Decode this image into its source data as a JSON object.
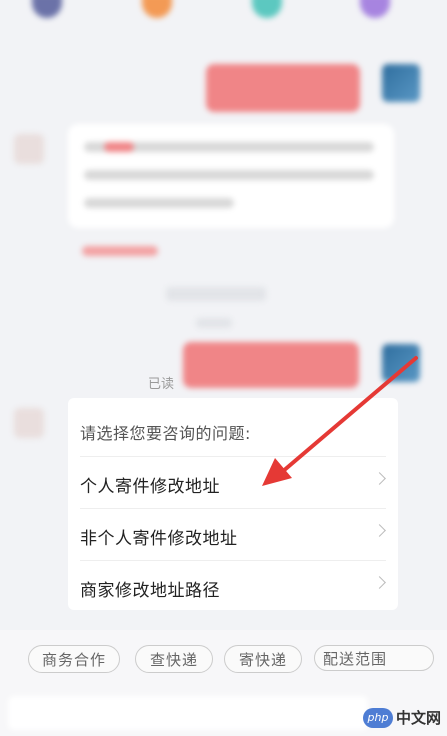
{
  "bot_menu": {
    "title": "请选择您要咨询的问题:",
    "items": [
      {
        "label": "个人寄件修改地址"
      },
      {
        "label": "非个人寄件修改地址"
      },
      {
        "label": "商家修改地址路径"
      }
    ]
  },
  "read_status": "已读",
  "quick_chips": [
    {
      "label": "商务合作"
    },
    {
      "label": "查快递"
    },
    {
      "label": "寄快递"
    },
    {
      "label": "配送范围"
    }
  ],
  "watermark": {
    "logo": "php",
    "text": "中文网"
  },
  "colors": {
    "arrow": "#e53935",
    "bubble": "#f08587",
    "background": "#f2f3f6"
  }
}
